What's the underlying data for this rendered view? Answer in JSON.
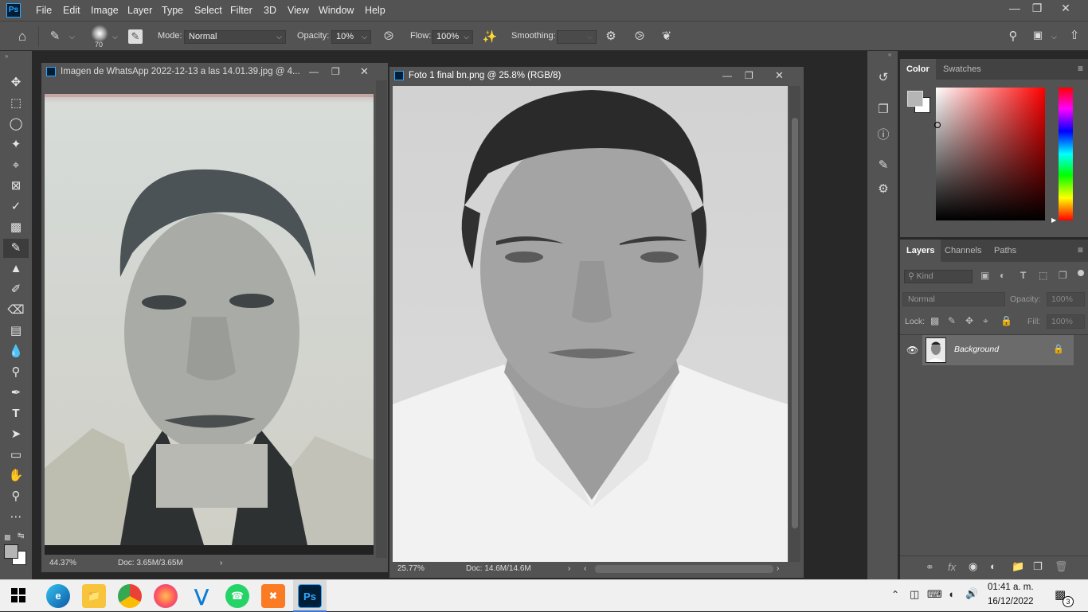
{
  "app": {
    "logo": "Ps",
    "accent": "#31a8ff"
  },
  "menu": [
    "File",
    "Edit",
    "Image",
    "Layer",
    "Type",
    "Select",
    "Filter",
    "3D",
    "View",
    "Window",
    "Help"
  ],
  "options": {
    "brush_size": "70",
    "mode_label": "Mode:",
    "mode_value": "Normal",
    "opacity_label": "Opacity:",
    "opacity_value": "10%",
    "flow_label": "Flow:",
    "flow_value": "100%",
    "smoothing_label": "Smoothing:",
    "smoothing_value": ""
  },
  "tools": [
    "move-tool",
    "marquee-tool",
    "lasso-tool",
    "magic-wand-tool",
    "crop-tool",
    "frame-tool",
    "eyedropper-tool",
    "healing-tool",
    "brush-tool",
    "stamp-tool",
    "history-brush-tool",
    "eraser-tool",
    "gradient-tool",
    "blur-tool",
    "dodge-tool",
    "pen-tool",
    "type-tool",
    "path-select-tool",
    "rectangle-tool",
    "hand-tool",
    "zoom-tool",
    "more-tools"
  ],
  "doc1": {
    "title": "Imagen de WhatsApp 2022-12-13 a las 14.01.39.jpg @ 4...",
    "zoom": "44.37%",
    "doc": "Doc: 3.65M/3.65M"
  },
  "doc2": {
    "title": "Foto 1 final bn.png @ 25.8% (RGB/8)",
    "zoom": "25.77%",
    "doc": "Doc: 14.6M/14.6M"
  },
  "color_panel": {
    "tabs": [
      "Color",
      "Swatches"
    ]
  },
  "layers_panel": {
    "tabs": [
      "Layers",
      "Channels",
      "Paths"
    ],
    "kind_placeholder": "Kind",
    "blend_mode": "Normal",
    "opacity_label": "Opacity:",
    "opacity_value": "100%",
    "lock_label": "Lock:",
    "fill_label": "Fill:",
    "fill_value": "100%",
    "layers": [
      {
        "name": "Background",
        "visible": true,
        "locked": true
      }
    ]
  },
  "taskbar": {
    "time": "01:41 a. m.",
    "date": "16/12/2022",
    "notifications": "3",
    "apps": [
      "edge",
      "file-explorer",
      "chrome",
      "firefox",
      "vscode",
      "whatsapp",
      "xampp",
      "photoshop"
    ]
  }
}
